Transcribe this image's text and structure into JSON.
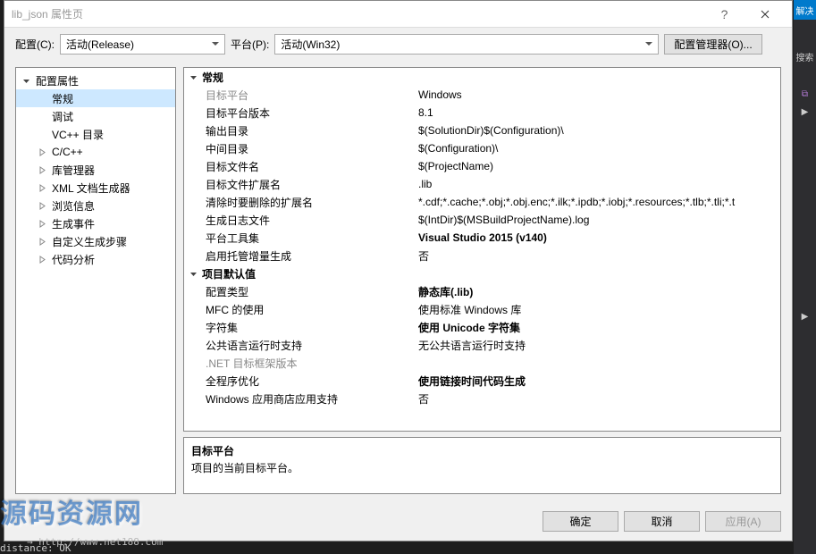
{
  "window": {
    "title": "lib_json 属性页",
    "help_symbol": "?",
    "close_label": "关闭"
  },
  "config_bar": {
    "config_label": "配置(C):",
    "config_value": "活动(Release)",
    "platform_label": "平台(P):",
    "platform_value": "活动(Win32)",
    "manager_btn": "配置管理器(O)..."
  },
  "sidebar": {
    "root": "配置属性",
    "items": [
      {
        "label": "常规",
        "selected": true
      },
      {
        "label": "调试"
      },
      {
        "label": "VC++ 目录"
      },
      {
        "label": "C/C++",
        "expandable": true
      },
      {
        "label": "库管理器",
        "expandable": true
      },
      {
        "label": "XML 文档生成器",
        "expandable": true
      },
      {
        "label": "浏览信息",
        "expandable": true
      },
      {
        "label": "生成事件",
        "expandable": true
      },
      {
        "label": "自定义生成步骤",
        "expandable": true
      },
      {
        "label": "代码分析",
        "expandable": true
      }
    ]
  },
  "sections": [
    {
      "title": "常规",
      "rows": [
        {
          "name": "目标平台",
          "value": "Windows",
          "readonly": true
        },
        {
          "name": "目标平台版本",
          "value": "8.1"
        },
        {
          "name": "输出目录",
          "value": "$(SolutionDir)$(Configuration)\\"
        },
        {
          "name": "中间目录",
          "value": "$(Configuration)\\"
        },
        {
          "name": "目标文件名",
          "value": "$(ProjectName)"
        },
        {
          "name": "目标文件扩展名",
          "value": ".lib"
        },
        {
          "name": "清除时要删除的扩展名",
          "value": "*.cdf;*.cache;*.obj;*.obj.enc;*.ilk;*.ipdb;*.iobj;*.resources;*.tlb;*.tli;*.t"
        },
        {
          "name": "生成日志文件",
          "value": "$(IntDir)$(MSBuildProjectName).log"
        },
        {
          "name": "平台工具集",
          "value": "Visual Studio 2015 (v140)",
          "bold": true
        },
        {
          "name": "启用托管增量生成",
          "value": "否"
        }
      ]
    },
    {
      "title": "项目默认值",
      "rows": [
        {
          "name": "配置类型",
          "value": "静态库(.lib)",
          "bold": true
        },
        {
          "name": "MFC 的使用",
          "value": "使用标准 Windows 库"
        },
        {
          "name": "字符集",
          "value": "使用 Unicode 字符集",
          "bold": true
        },
        {
          "name": "公共语言运行时支持",
          "value": "无公共语言运行时支持"
        },
        {
          "name": ".NET 目标框架版本",
          "value": "",
          "readonly": true
        },
        {
          "name": "全程序优化",
          "value": "使用链接时间代码生成",
          "bold": true
        },
        {
          "name": "Windows 应用商店应用支持",
          "value": "否"
        }
      ]
    }
  ],
  "description": {
    "title": "目标平台",
    "text": "项目的当前目标平台。"
  },
  "buttons": {
    "ok": "确定",
    "cancel": "取消",
    "apply": "应用(A)"
  },
  "right_strip": {
    "top": "解决",
    "search": "搜索"
  },
  "watermark": {
    "text": "源码资源网",
    "url": "→ http://www.net188.com"
  },
  "terminal": "distance: OK"
}
